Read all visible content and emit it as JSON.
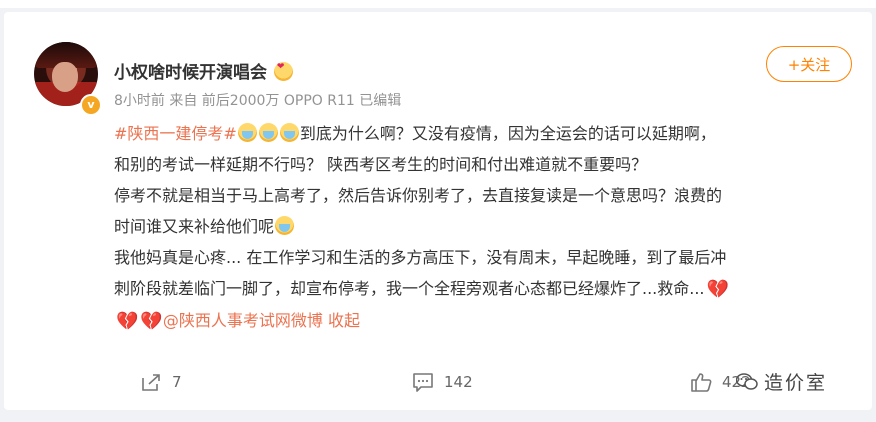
{
  "post": {
    "username": "小权啥时候开演唱会",
    "user_emoji": "love-eyes-emoji",
    "meta": "8小时前 来自 前后2000万 OPPO R11 已编辑",
    "follow_label": "+关注",
    "content": {
      "topic": "#陕西一建停考#",
      "line1_text": "到底为什么啊？又没有疫情，因为全运会的话可以延期啊，",
      "line2_text": "和别的考试一样延期不行吗？ 陕西考区考生的时间和付出难道就不重要吗？",
      "line3_text": "停考不就是相当于马上高考了，然后告诉你别考了，去直接复读是一个意思吗？浪费的",
      "line4_text": "时间谁又来补给他们呢",
      "line5_text": "我他妈真是心疼... 在工作学习和生活的多方高压下，没有周末，早起晚睡，到了最后冲",
      "line6_text": "刺阶段就差临门一脚了，却宣布停考，我一个全程旁观者心态都已经爆炸了...救命...",
      "mention": "@陕西人事考试网微博",
      "collapse_label": "收起"
    },
    "actions": {
      "share_count": "7",
      "comment_count": "142",
      "like_count": "422"
    },
    "watermark_text": "造价室"
  },
  "colors": {
    "accent": "#ff8200",
    "link": "#eb7350",
    "meta": "#939393"
  }
}
